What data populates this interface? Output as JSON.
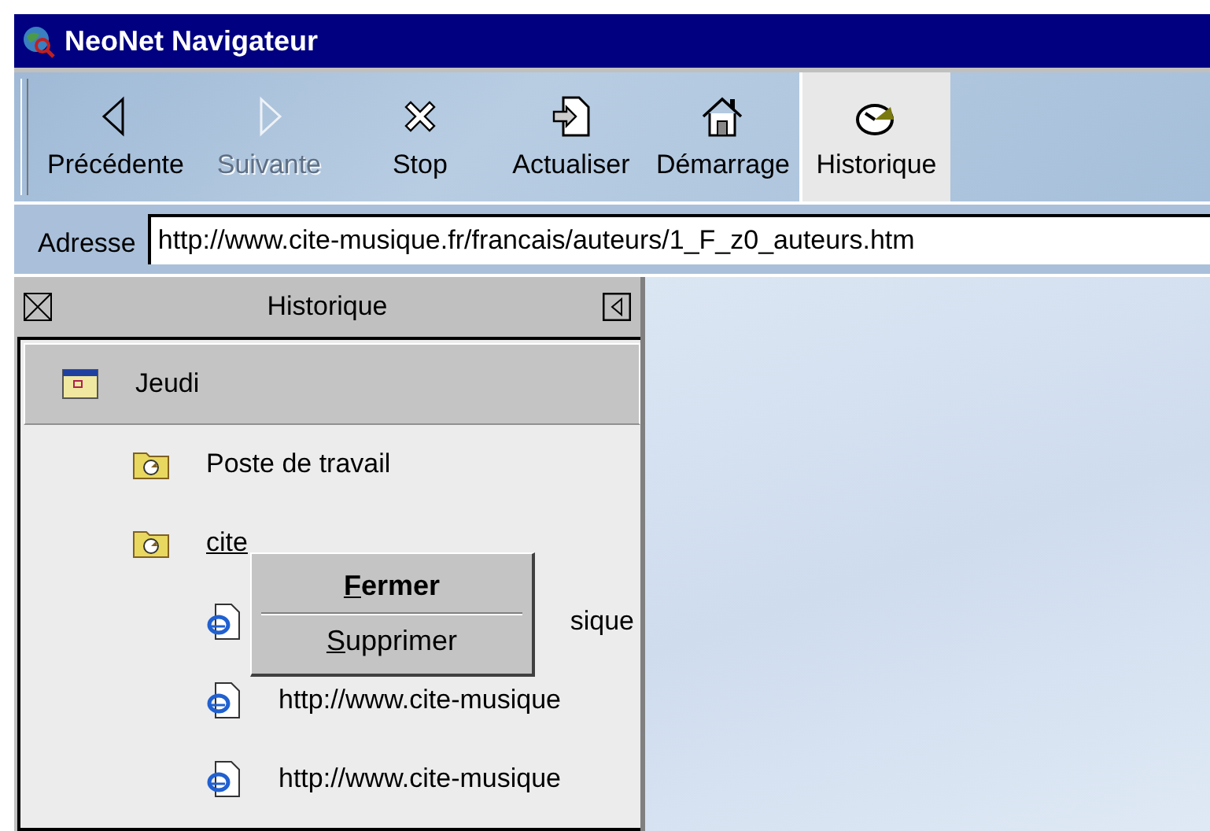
{
  "window": {
    "title": "NeoNet Navigateur"
  },
  "toolbar": [
    {
      "label": "Précédente",
      "kind": "back",
      "disabled": false,
      "selected": false
    },
    {
      "label": "Suivante",
      "kind": "forward",
      "disabled": true,
      "selected": false
    },
    {
      "label": "Stop",
      "kind": "stop",
      "disabled": false,
      "selected": false
    },
    {
      "label": "Actualiser",
      "kind": "refresh",
      "disabled": false,
      "selected": false
    },
    {
      "label": "Démarrage",
      "kind": "home",
      "disabled": false,
      "selected": false
    },
    {
      "label": "Historique",
      "kind": "history",
      "disabled": false,
      "selected": true
    }
  ],
  "address": {
    "label": "Adresse",
    "value": "http://www.cite-musique.fr/francais/auteurs/1_F_z0_auteurs.htm"
  },
  "history_panel": {
    "title": "Historique",
    "tree": [
      {
        "label": "Jeudi",
        "kind": "day",
        "selected": true,
        "children": [
          {
            "label": "Poste de travail",
            "kind": "folder",
            "selected": false
          },
          {
            "label": "cite",
            "kind": "folder",
            "selected": false,
            "children": [
              {
                "label": "sique",
                "kind": "page",
                "selected": false
              },
              {
                "label": "http://www.cite-musique",
                "kind": "page",
                "selected": false
              },
              {
                "label": "http://www.cite-musique",
                "kind": "page",
                "selected": false
              }
            ]
          }
        ]
      }
    ]
  },
  "context_menu": [
    {
      "label": "Fermer",
      "default": true
    },
    {
      "label": "Supprimer",
      "default": false
    }
  ]
}
